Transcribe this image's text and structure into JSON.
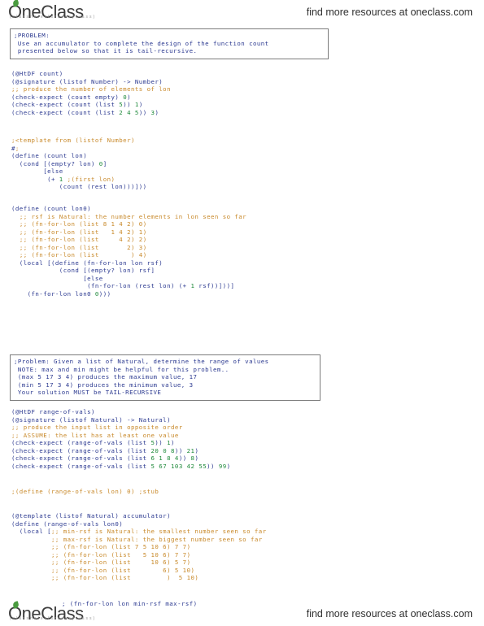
{
  "brand": {
    "logo_text": "OneClass",
    "logo_sub": "( c l a s s   n o t e s   f o r   e v e r y   c l a s s )",
    "leaf_icon": "leaf-icon",
    "tagline": "find more resources at oneclass.com"
  },
  "document": {
    "language": "racket",
    "colors": {
      "code": "#2b3990",
      "comment": "#c8892a",
      "literal": "#1f8a3b",
      "box_border": "#7c7c7c",
      "background": "#ffffff"
    }
  },
  "problem_box_1": {
    "name": "problem-statement-box",
    "lines": [
      ";PROBLEM:",
      " Use an accumulator to complete the design of the function count",
      " presented below so that it is tail-recursive."
    ],
    "text": ";PROBLEM:\n Use an accumulator to complete the design of the function count\n presented below so that it is tail-recursive."
  },
  "problem_box_2": {
    "name": "problem-statement-box",
    "lines": [
      ";Problem: Given a list of Natural, determine the range of values",
      " NOTE: max and min might be helpful for this problem..",
      " (max 5 17 3 4) produces the maximum value, 17",
      " (min 5 17 3 4) produces the minimum value, 3",
      " Your solution MUST be TAIL-RECURSIVE"
    ],
    "text": ";Problem: Given a list of Natural, determine the range of values\n NOTE: max and min might be helpful for this problem..\n (max 5 17 3 4) produces the maximum value, 17\n (min 5 17 3 4) produces the minimum value, 3\n Your solution MUST be TAIL-RECURSIVE"
  },
  "code_count_data": {
    "name": "count-signature-and-tests",
    "text": "(@HtDF count)\n(@signature (listof Number) -> Number)\n;; produce the number of elements of lon\n(check-expect (count empty) 0)\n(check-expect (count (list 5)) 1)\n(check-expect (count (list 2 4 5)) 3)"
  },
  "code_count_template": {
    "name": "count-template-commented-out",
    "text": ";<template from (listof Number)\n#;\n(define (count lon)\n  (cond [(empty? lon) 0]\n        [else\n         (+ 1 ;(first lon)\n            (count (rest lon)))]))"
  },
  "code_count_accumulator": {
    "name": "count-accumulator-solution",
    "text": "(define (count lon0)\n  ;; rsf is Natural: the number elements in lon seen so far\n  ;; (fn-for-lon (list 8 1 4 2) 0)\n  ;; (fn-for-lon (list   1 4 2) 1)\n  ;; (fn-for-lon (list     4 2) 2)\n  ;; (fn-for-lon (list       2) 3)\n  ;; (fn-for-lon (list        ) 4)\n  (local [(define (fn-for-lon lon rsf)\n            (cond [(empty? lon) rsf]\n                  [else\n                   (fn-for-lon (rest lon) (+ 1 rsf))]))]\n    (fn-for-lon lon0 0)))"
  },
  "code_range_data": {
    "name": "range-of-vals-signature-and-tests",
    "text": "(@HtDF range-of-vals)\n(@signature (listof Natural) -> Natural)\n;; produce the input list in opposite order\n;; ASSUME: the list has at least one value\n(check-expect (range-of-vals (list 5)) 1)\n(check-expect (range-of-vals (list 20 0 8)) 21)\n(check-expect (range-of-vals (list 6 1 8 4)) 8)\n(check-expect (range-of-vals (list 5 67 103 42 55)) 99)"
  },
  "code_range_stub": {
    "name": "range-of-vals-stub",
    "text": ";(define (range-of-vals lon) 0) ;stub"
  },
  "code_range_accumulator": {
    "name": "range-of-vals-accumulator-template",
    "text": "(@template (listof Natural) accumulator)\n(define (range-of-vals lon0)\n  (local [;; min-rsf is Natural: the smallest number seen so far\n          ;; max-rsf is Natural: the biggest number seen so far\n          ;; (fn-for-lon (list 7 5 10 6) 7 7)\n          ;; (fn-for-lon (list   5 10 6) 7 7)\n          ;; (fn-for-lon (list     10 6) 5 7)\n          ;; (fn-for-lon (list        6) 5 10)\n          ;; (fn-for-lon (list         )  5 10)"
  },
  "code_range_last_line": {
    "name": "range-of-vals-final-call",
    "text": "; (fn-for-lon lon min-rsf max-rsf)"
  }
}
